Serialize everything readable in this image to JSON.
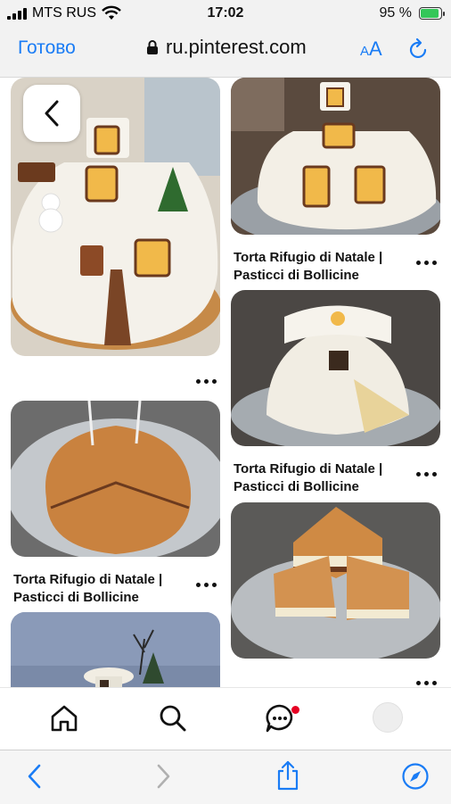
{
  "status_bar": {
    "carrier": "MTS RUS",
    "time": "17:02",
    "battery_percent": "95 %",
    "battery_level": 0.95
  },
  "browser": {
    "done_label": "Готово",
    "url": "ru.pinterest.com",
    "text_size_label": "AA"
  },
  "pins": [
    {
      "id": "left-1",
      "caption": "",
      "image": "igloo cake with lit windows, snowman and tree"
    },
    {
      "id": "right-1",
      "caption": "Torta Rifugio di Natale | Pasticci di Bollicine",
      "image": "white house cake with lit windows"
    },
    {
      "id": "right-2",
      "caption": "Torta Rifugio di Natale | Pasticci di Bollicine",
      "image": "igloo dome cake with slice cut"
    },
    {
      "id": "left-2",
      "caption": "Torta Rifugio di Natale | Pasticci di Bollicine",
      "image": "sponge cake base on board"
    },
    {
      "id": "right-3",
      "caption": "",
      "image": "layered sponge cake with wedge cut"
    },
    {
      "id": "left-3",
      "caption": "",
      "image": "snowy dome cake with tree"
    }
  ],
  "pinterest_nav": {
    "items": [
      "home-icon",
      "search-icon",
      "messages-icon",
      "profile-avatar"
    ],
    "messages_badge": true
  },
  "safari_toolbar": {
    "items": [
      "back-icon",
      "forward-icon",
      "share-icon",
      "compass-icon"
    ]
  }
}
